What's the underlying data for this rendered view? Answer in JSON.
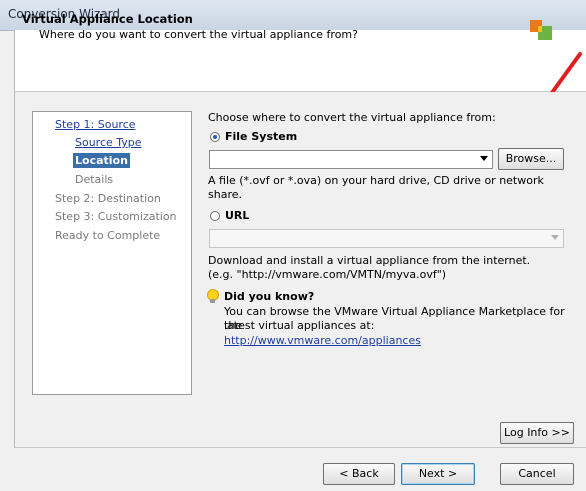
{
  "window": {
    "title": "Conversion Wizard"
  },
  "header": {
    "title": "Virtual Appliance Location",
    "subtitle": "Where do you want to convert the virtual appliance from?"
  },
  "steps": {
    "step1": "Step 1: Source",
    "source_type": "Source Type",
    "location": "Location",
    "details": "Details",
    "step2": "Step 2: Destination",
    "step3": "Step 3: Customization",
    "ready": "Ready to Complete"
  },
  "main": {
    "prompt": "Choose where to convert the virtual appliance from:",
    "file_system": {
      "label": "File System",
      "selected": true,
      "value": "",
      "browse_label": "Browse...",
      "help_line1": "A file (*.ovf or *.ova) on your hard drive, CD drive or network",
      "help_line2": "share."
    },
    "url": {
      "label": "URL",
      "selected": false,
      "value": "",
      "help_line1": "Download and install a virtual appliance from the internet.",
      "help_line2": "(e.g. \"http://vmware.com/VMTN/myva.ovf\")"
    },
    "tip": {
      "title": "Did you know?",
      "line1": "You can browse the VMware Virtual Appliance Marketplace for the",
      "line2": "latest virtual appliances at:",
      "link": "http://www.vmware.com/appliances"
    }
  },
  "buttons": {
    "log_info": "Log Info >>",
    "back": "< Back",
    "next": "Next >",
    "cancel": "Cancel"
  },
  "colors": {
    "selected_step_bg": "#3a6ea8",
    "link": "#1f3d9e",
    "annotation_arrow": "#e02020"
  },
  "icons": {
    "header_logo": "vmware-logo-icon",
    "tip": "lightbulb-icon",
    "annotation": "red-arrow-annotation"
  }
}
